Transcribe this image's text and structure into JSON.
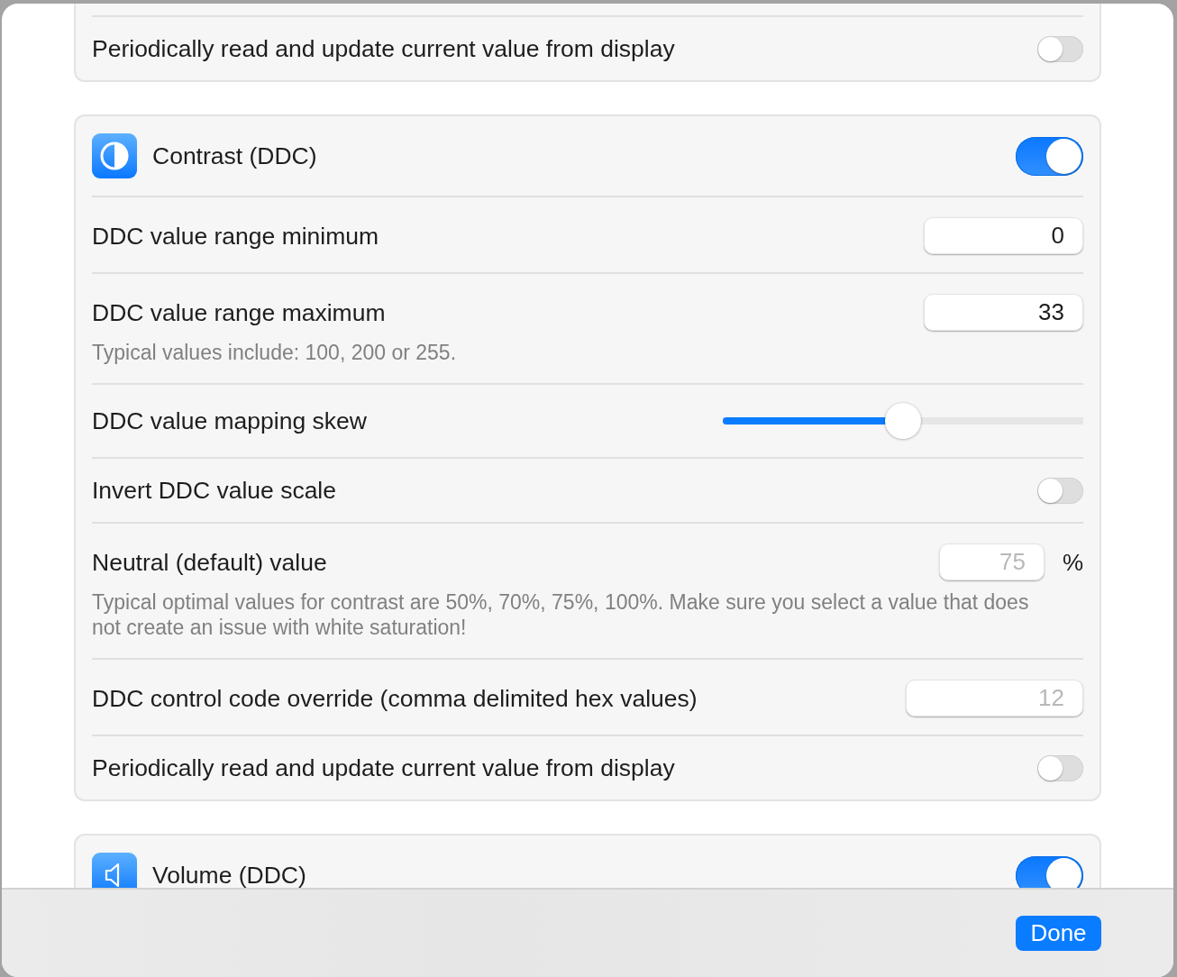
{
  "sections": [
    {
      "rows": [
        {
          "kind": "toggle",
          "label": "Periodically read and update current value from display",
          "on": false
        }
      ]
    },
    {
      "header": {
        "kind": "contrast",
        "title": "Contrast (DDC)",
        "on": true
      },
      "rows": [
        {
          "kind": "number",
          "label": "DDC value range minimum",
          "value": "0"
        },
        {
          "kind": "number",
          "label": "DDC value range maximum",
          "value": "33",
          "note": "Typical values include: 100, 200 or 255."
        },
        {
          "kind": "slider",
          "label": "DDC value mapping skew",
          "level": 0.5
        },
        {
          "kind": "toggle",
          "label": "Invert DDC value scale",
          "on": false
        },
        {
          "kind": "percent",
          "label": "Neutral (default) value",
          "placeholder": "75",
          "unit": "%",
          "note": "Typical optimal values for contrast are 50%, 70%, 75%, 100%. Make sure you select a value that does not create an issue with white saturation!"
        },
        {
          "kind": "text",
          "label": "DDC control code override (comma delimited hex values)",
          "placeholder": "12"
        },
        {
          "kind": "toggle",
          "label": "Periodically read and update current value from display",
          "on": false
        }
      ]
    },
    {
      "header": {
        "kind": "volume",
        "title": "Volume (DDC)",
        "on": true
      }
    }
  ],
  "footer": {
    "done_button": "Done"
  }
}
